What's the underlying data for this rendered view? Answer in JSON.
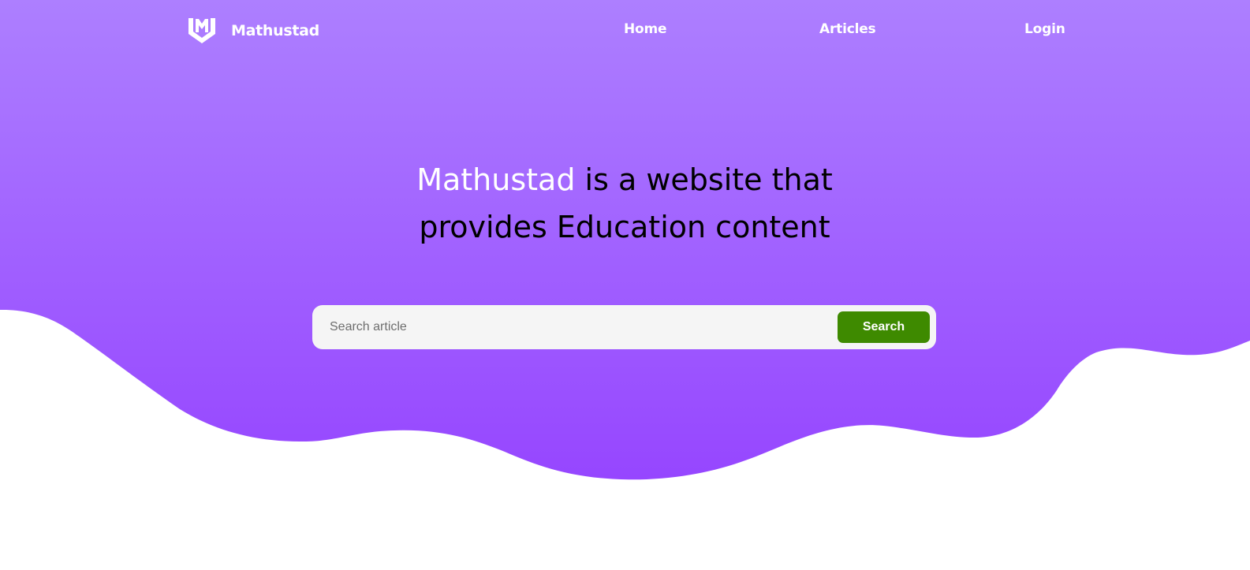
{
  "brand": {
    "name": "Mathustad",
    "logo_icon": "shield-m-logo-icon"
  },
  "nav": {
    "items": [
      {
        "label": "Home"
      },
      {
        "label": "Articles"
      },
      {
        "label": "Login"
      }
    ]
  },
  "hero": {
    "headline_brand": "Mathustad",
    "headline_rest_line1": " is a website that",
    "headline_line2": "provides Education content"
  },
  "search": {
    "placeholder": "Search article",
    "value": "",
    "button_label": "Search",
    "search_icon": "none"
  },
  "colors": {
    "hero_gradient_top": "#ad7fff",
    "hero_gradient_bottom": "#9646ff",
    "brand_text": "#ffffff",
    "headline_text": "#000000",
    "search_button": "#3e8a00",
    "search_bar": "#f5f5f5"
  }
}
